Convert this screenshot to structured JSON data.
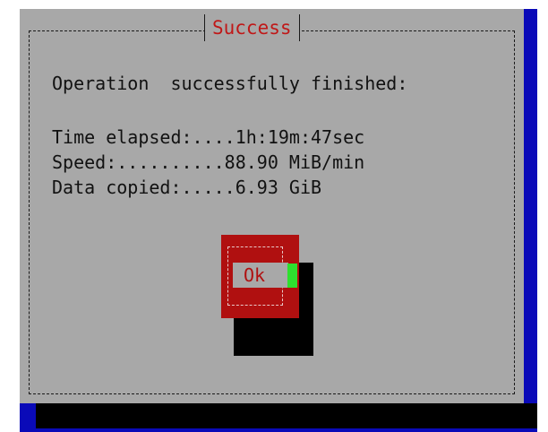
{
  "dialog": {
    "title": "Success",
    "message": "Operation  successfully finished:",
    "stats": [
      "Time elapsed:....1h:19m:47sec",
      "Speed:..........88.90 MiB/min",
      "Data copied:.....6.93 GiB"
    ],
    "ok_label": "Ok"
  },
  "colors": {
    "screen_background": "#0a0ab8",
    "dialog_background": "#a8a8a8",
    "title_text": "#c01818",
    "button_background": "#b01010",
    "cursor": "#2ee02e"
  }
}
